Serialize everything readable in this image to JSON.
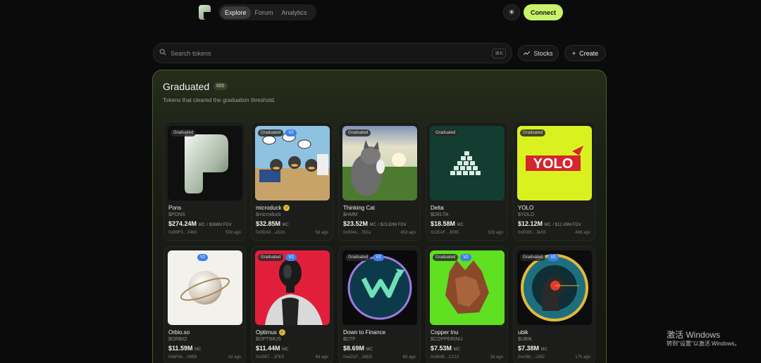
{
  "header": {
    "tabs": [
      {
        "label": "Explore",
        "active": true
      },
      {
        "label": "Forum",
        "active": false
      },
      {
        "label": "Analytics",
        "active": false
      }
    ],
    "theme_icon": "sun-icon",
    "connect_label": "Connect"
  },
  "search": {
    "placeholder": "Search tokens",
    "shortcut": "⌘K"
  },
  "actions": {
    "stocks_label": "Stocks",
    "create_label": "Create"
  },
  "section": {
    "title": "Graduated",
    "count": "665",
    "subtitle": "Tokens that cleared the graduation threshold."
  },
  "tokens": [
    {
      "name": "Pons",
      "ticker": "$PONS",
      "mc": "$274.24M",
      "fdv": "/ $368M FDV",
      "address": "0xB9F5…24b0",
      "age": "50d ago",
      "graduated": true,
      "v2": false,
      "verified": false
    },
    {
      "name": "microduck",
      "ticker": "$microduck",
      "mc": "$32.85M",
      "fdv": "",
      "address": "0x0DA8…a52d",
      "age": "5d ago",
      "graduated": true,
      "v2": true,
      "verified": true
    },
    {
      "name": "Thinking Cat",
      "ticker": "$HMM",
      "mc": "$23.52M",
      "fdv": "/ $23.82M FDV",
      "address": "0x934e…782a",
      "age": "45d ago",
      "graduated": true,
      "v2": false,
      "verified": false
    },
    {
      "name": "Delta",
      "ticker": "$DELTA",
      "mc": "$18.58M",
      "fdv": "",
      "address": "0x1EAF…B0f8",
      "age": "32d ago",
      "graduated": true,
      "v2": false,
      "verified": false
    },
    {
      "name": "YOLO",
      "ticker": "$YOLO",
      "mc": "$12.12M",
      "fdv": "/ $12.49M FDV",
      "address": "0xE0b5…3e55",
      "age": "49d ago",
      "graduated": true,
      "v2": false,
      "verified": false
    },
    {
      "name": "Orbio.so",
      "ticker": "$ORBIO",
      "mc": "$11.59M",
      "fdv": "",
      "address": "0xbFAb…04B8",
      "age": "1d ago",
      "graduated": false,
      "v2": true,
      "verified": false
    },
    {
      "name": "Optimus",
      "ticker": "$OPTIMUS",
      "mc": "$11.44M",
      "fdv": "",
      "address": "0x3057…1FE5",
      "age": "4d ago",
      "graduated": true,
      "v2": true,
      "verified": true
    },
    {
      "name": "Down to Finance",
      "ticker": "$DTF",
      "mc": "$8.69M",
      "fdv": "",
      "address": "0xeD1F…d6D5",
      "age": "8d ago",
      "graduated": true,
      "v2": true,
      "verified": false
    },
    {
      "name": "Copper Inu",
      "ticker": "$COPPERINU",
      "mc": "$7.53M",
      "fdv": "",
      "address": "0x9848…C212",
      "age": "3d ago",
      "graduated": true,
      "v2": true,
      "verified": false
    },
    {
      "name": "ubik",
      "ticker": "$UBIK",
      "mc": "$7.38M",
      "fdv": "",
      "address": "0xc08c…c362",
      "age": "17h ago",
      "graduated": true,
      "v2": true,
      "verified": false
    }
  ],
  "labels": {
    "graduated_badge": "Graduated",
    "v2_badge": "V2",
    "mc_unit": "MC"
  },
  "watermark": {
    "line1": "激活 Windows",
    "line2": "转到\"设置\"以激活 Windows。"
  }
}
